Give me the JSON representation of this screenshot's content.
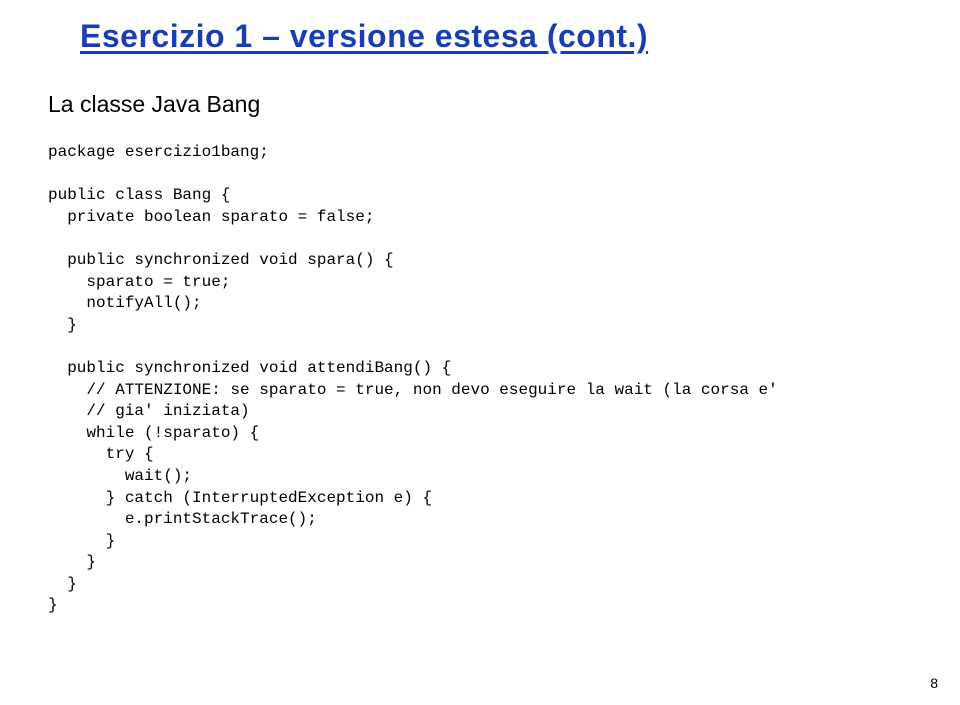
{
  "title": "Esercizio 1 – versione estesa (cont.)",
  "subtitle": "La classe Java Bang",
  "code": "package esercizio1bang;\n\npublic class Bang {\n  private boolean sparato = false;\n\n  public synchronized void spara() {\n    sparato = true;\n    notifyAll();\n  }\n\n  public synchronized void attendiBang() {\n    // ATTENZIONE: se sparato = true, non devo eseguire la wait (la corsa e'\n    // gia' iniziata)\n    while (!sparato) {\n      try {\n        wait();\n      } catch (InterruptedException e) {\n        e.printStackTrace();\n      }\n    }\n  }\n}",
  "page_number": "8"
}
